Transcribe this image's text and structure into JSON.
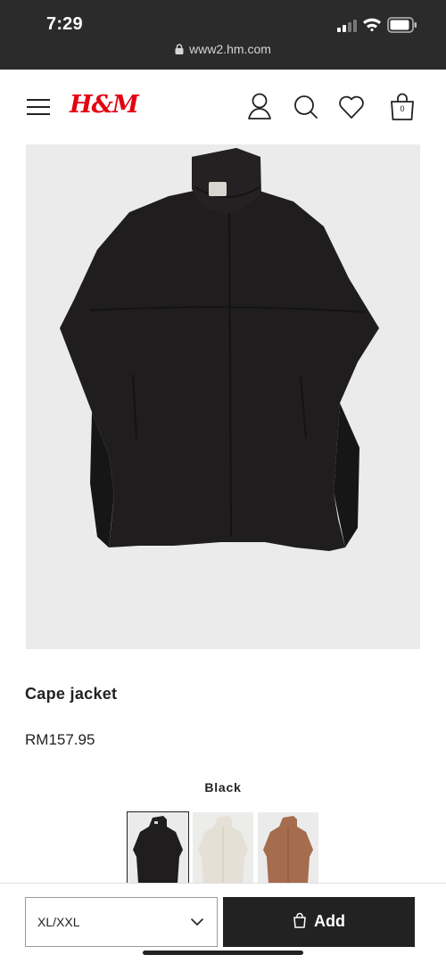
{
  "status_bar": {
    "time": "7:29",
    "url": "www2.hm.com"
  },
  "header": {
    "logo": "H&M",
    "bag_count": "0",
    "icons": [
      "menu-icon",
      "account-icon",
      "search-icon",
      "heart-icon",
      "bag-icon"
    ]
  },
  "product": {
    "title": "Cape jacket",
    "price": "RM157.95",
    "color_name": "Black",
    "swatches": [
      {
        "color": "#1f1d1e",
        "label": "black",
        "selected": true
      },
      {
        "color": "#e4e0d6",
        "label": "light beige",
        "selected": false
      },
      {
        "color": "#a56c4e",
        "label": "brown",
        "selected": false
      }
    ]
  },
  "bottom_bar": {
    "size_value": "XL/XXL",
    "add_label": "Add"
  },
  "colors": {
    "brand": "#e50010",
    "dark": "#222222",
    "image_bg": "#ebebeb"
  }
}
